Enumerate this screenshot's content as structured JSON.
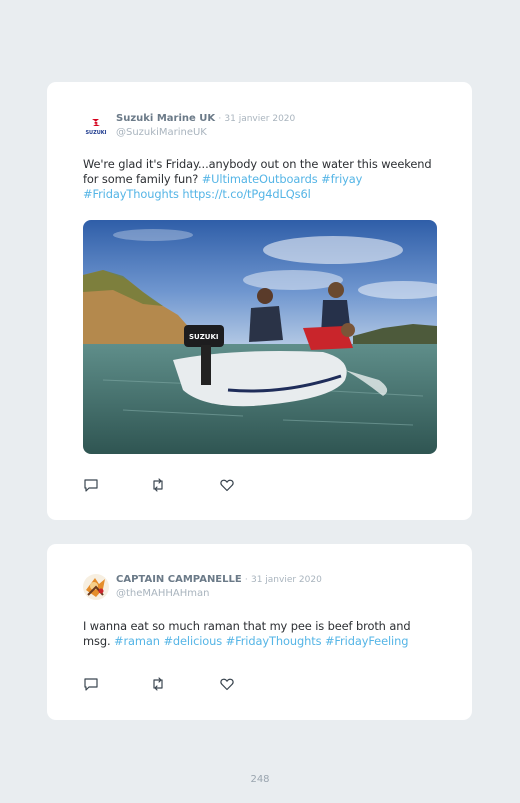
{
  "tweets": [
    {
      "author": "Suzuki Marine UK",
      "separator": "·",
      "date": "31 janvier 2020",
      "handle": "@SuzukiMarineUK",
      "avatar_text": "SUZUKI",
      "text_plain": "We're glad it's Friday...anybody out on the water this weekend for some family fun? ",
      "links": [
        "#UltimateOutboards",
        "#friyay",
        "#FridayThoughts",
        "https://t.co/tPg4dLQs6l"
      ],
      "image_text": "SUZUKI",
      "actions": [
        "reply-icon",
        "retweet-icon",
        "like-icon"
      ]
    },
    {
      "author": "CAPTAIN CAMPANELLE",
      "separator": "·",
      "date": "31 janvier 2020",
      "handle": "@theMAHHAHman",
      "text_plain": "I wanna eat so much raman that my pee is beef broth and msg. ",
      "links": [
        "#raman",
        "#delicious",
        "#FridayThoughts",
        "#FridayFeeling"
      ],
      "actions": [
        "reply-icon",
        "retweet-icon",
        "like-icon"
      ]
    }
  ],
  "page_number": "248",
  "colors": {
    "background": "#e9edf0",
    "card": "#ffffff",
    "link": "#55b5e6",
    "name": "#6b7a88",
    "muted": "#a9b4be",
    "brand_red": "#d6001c",
    "brand_blue": "#1f3c8f"
  }
}
